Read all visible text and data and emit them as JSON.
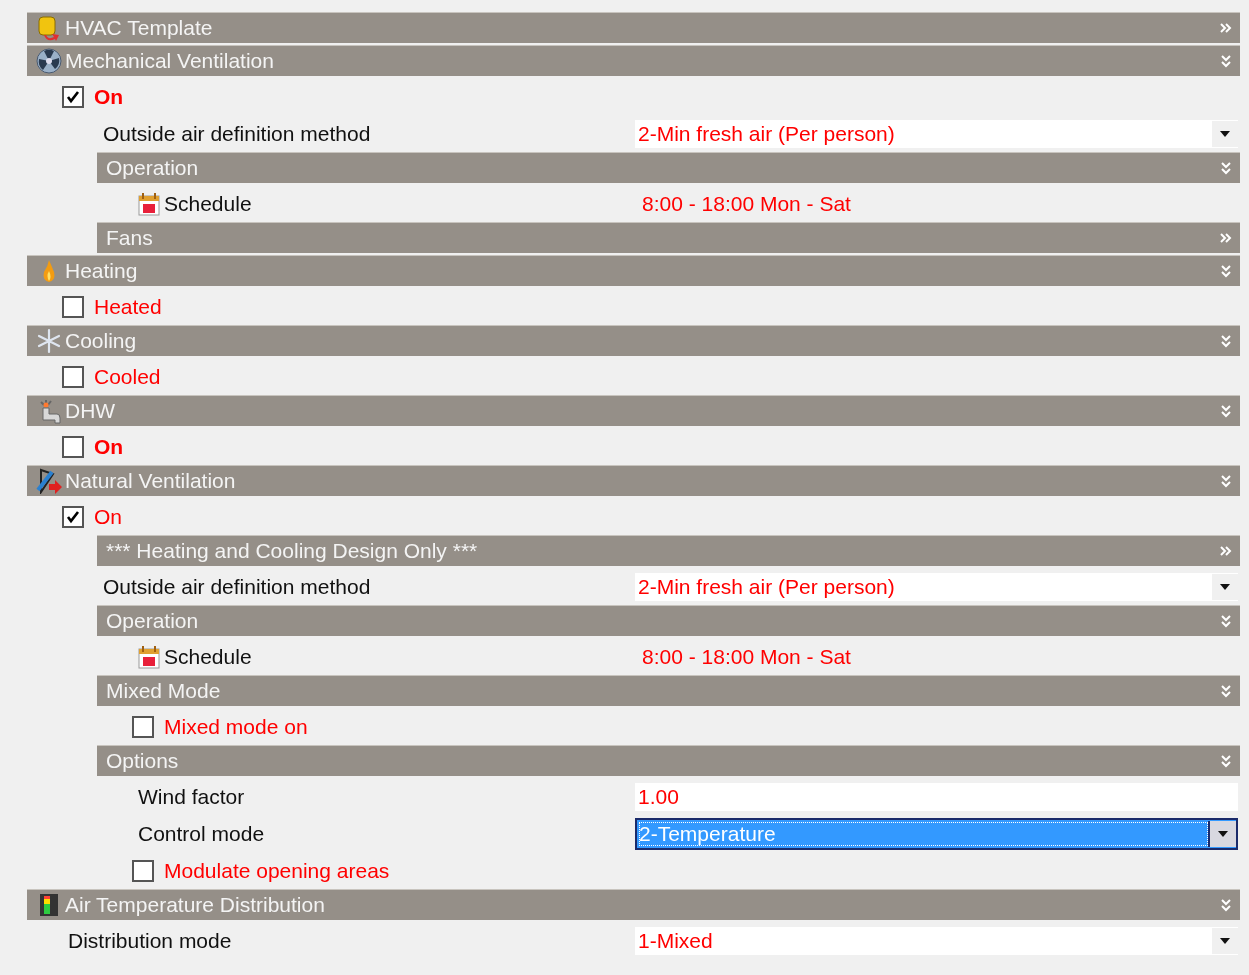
{
  "items": [
    {
      "kind": "header",
      "title": "HVAC Template",
      "expanded": false
    },
    {
      "kind": "header",
      "title": "Mechanical Ventilation",
      "expanded": true,
      "children": [
        {
          "kind": "checkbox",
          "label": "On",
          "checked": true,
          "bold": true,
          "children": [
            {
              "kind": "dropdown",
              "label": "Outside air definition method",
              "value": "2-Min fresh air (Per person)",
              "selected": false
            },
            {
              "kind": "header",
              "title": "Operation",
              "expanded": true,
              "children": [
                {
                  "kind": "schedule",
                  "label": "Schedule",
                  "value": "8:00 - 18:00 Mon - Sat"
                }
              ]
            },
            {
              "kind": "header",
              "title": "Fans",
              "expanded": false
            }
          ]
        }
      ]
    },
    {
      "kind": "header",
      "title": "Heating",
      "expanded": true,
      "children": [
        {
          "kind": "checkbox",
          "label": "Heated",
          "checked": false,
          "bold": false
        }
      ]
    },
    {
      "kind": "header",
      "title": "Cooling",
      "expanded": true,
      "children": [
        {
          "kind": "checkbox",
          "label": "Cooled",
          "checked": false,
          "bold": false
        }
      ]
    },
    {
      "kind": "header",
      "title": "DHW",
      "expanded": true,
      "children": [
        {
          "kind": "checkbox",
          "label": "On",
          "checked": false,
          "bold": true
        }
      ]
    },
    {
      "kind": "header",
      "title": "Natural Ventilation",
      "expanded": true,
      "children": [
        {
          "kind": "checkbox",
          "label": "On",
          "checked": true,
          "bold": false,
          "children": [
            {
              "kind": "header",
              "title": "*** Heating and Cooling Design Only ***",
              "expanded": false
            },
            {
              "kind": "dropdown",
              "label": "Outside air definition method",
              "value": "2-Min fresh air (Per person)",
              "selected": false
            },
            {
              "kind": "header",
              "title": "Operation",
              "expanded": true,
              "children": [
                {
                  "kind": "schedule",
                  "label": "Schedule",
                  "value": "8:00 - 18:00 Mon - Sat"
                }
              ]
            },
            {
              "kind": "header",
              "title": "Mixed Mode",
              "expanded": true,
              "children": [
                {
                  "kind": "checkbox",
                  "label": "Mixed mode on",
                  "checked": false,
                  "bold": false
                }
              ]
            },
            {
              "kind": "header",
              "title": "Options",
              "expanded": true,
              "children": [
                {
                  "kind": "field",
                  "label": "Wind factor",
                  "value": "1.00"
                },
                {
                  "kind": "dropdown",
                  "label": "Control mode",
                  "value": "2-Temperature",
                  "selected": true
                },
                {
                  "kind": "checkbox",
                  "label": "Modulate opening areas",
                  "checked": false,
                  "bold": false
                }
              ]
            }
          ]
        }
      ]
    },
    {
      "kind": "header",
      "title": "Air Temperature Distribution",
      "expanded": true,
      "children": [
        {
          "kind": "dropdown",
          "label": "Distribution mode",
          "value": "1-Mixed",
          "selected": false
        }
      ]
    }
  ]
}
